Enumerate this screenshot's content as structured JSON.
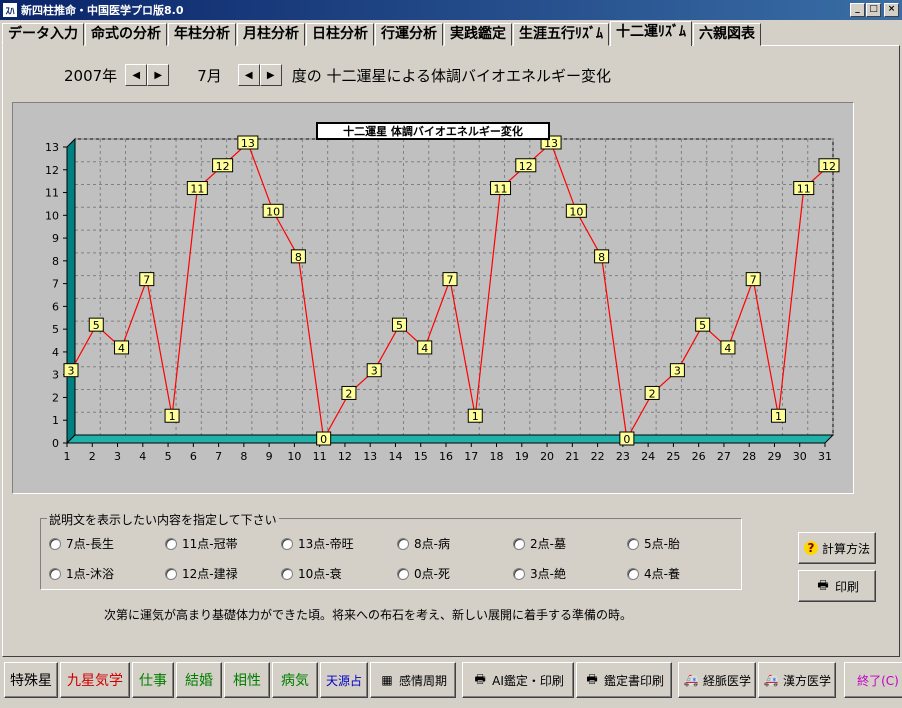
{
  "window": {
    "title": "新四柱推命・中国医学プロ版8.0",
    "icon_text": "ｽﾊ"
  },
  "tabs": [
    {
      "label": "データ入力"
    },
    {
      "label": "命式の分析"
    },
    {
      "label": "年柱分析"
    },
    {
      "label": "月柱分析"
    },
    {
      "label": "日柱分析"
    },
    {
      "label": "行運分析"
    },
    {
      "label": "実践鑑定"
    },
    {
      "label": "生涯五行ﾘｽﾞﾑ"
    },
    {
      "label": "十二運ﾘｽﾞﾑ",
      "active": true
    },
    {
      "label": "六親図表"
    }
  ],
  "header": {
    "year": "2007年",
    "month": "7月",
    "title": "度の 十二運星による体調バイオエネルギー変化"
  },
  "chart_data": {
    "type": "line",
    "title": "十二運星 体調バイオエネルギー変化",
    "x": [
      1,
      2,
      3,
      4,
      5,
      6,
      7,
      8,
      9,
      10,
      11,
      12,
      13,
      14,
      15,
      16,
      17,
      18,
      19,
      20,
      21,
      22,
      23,
      24,
      25,
      26,
      27,
      28,
      29,
      30,
      31
    ],
    "series": [
      {
        "values": [
          3,
          5,
          4,
          7,
          1,
          11,
          12,
          13,
          10,
          8,
          0,
          2,
          3,
          5,
          4,
          7,
          1,
          11,
          12,
          13,
          10,
          8,
          0,
          2,
          3,
          5,
          4,
          7,
          1,
          11,
          12
        ]
      }
    ],
    "ylim": [
      0,
      13
    ],
    "yticks": [
      0,
      1,
      2,
      3,
      4,
      5,
      6,
      7,
      8,
      9,
      10,
      11,
      12,
      13
    ],
    "grid": true,
    "line_color": "#ff0000",
    "label_bg": "#ffff99",
    "wall_color": "#008080"
  },
  "options": {
    "legend": "説明文を表示したい内容を指定して下さい",
    "row1": [
      "7点-長生",
      "11点-冠帯",
      "13点-帝旺",
      "8点-病",
      "2点-墓",
      "5点-胎"
    ],
    "row2": [
      "1点-沐浴",
      "12点-建禄",
      "10点-衰",
      "0点-死",
      "3点-絶",
      "4点-養"
    ]
  },
  "description": "次第に運気が高まり基礎体力ができた頃。将来への布石を考え、新しい展開に着手する準備の時。",
  "side": {
    "calc": "計算方法",
    "print": "印刷"
  },
  "bottom": {
    "tokusatsu": "特殊星",
    "kyusei": "九星気学",
    "shigoto": "仕事",
    "kekkon": "結婚",
    "aisho": "相性",
    "byoki": "病気",
    "tengen": "天源占",
    "kanjo": "感情周期",
    "ai": "AI鑑定・印刷",
    "kantei": "鑑定書印刷",
    "keiraku": "経脈医学",
    "kampo": "漢方医学",
    "end": "終了(C)"
  }
}
